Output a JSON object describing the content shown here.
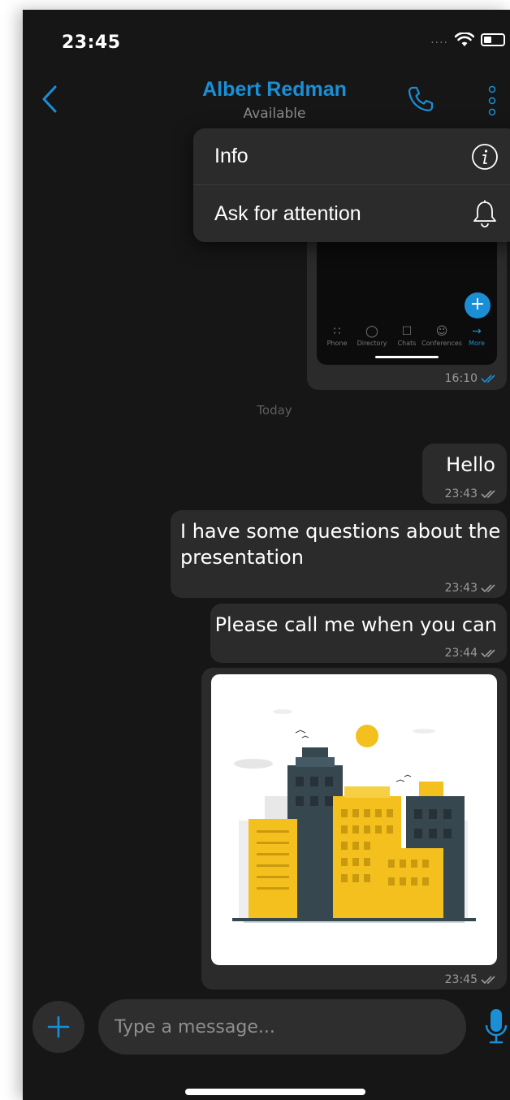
{
  "status_bar": {
    "time": "23:45",
    "signal": "....",
    "wifi_icon": "wifi-icon",
    "battery_icon": "battery-icon"
  },
  "header": {
    "back_icon": "chevron-left-icon",
    "contact_name": "Albert Redman",
    "contact_status": "Available",
    "call_icon": "phone-icon",
    "more_icon": "more-vertical-icon"
  },
  "menu": {
    "items": [
      {
        "label": "Info",
        "icon": "info-icon"
      },
      {
        "label": "Ask for attention",
        "icon": "bell-icon"
      }
    ]
  },
  "previous_message": {
    "nav_items": [
      "Phone",
      "Directory",
      "Chats",
      "Conferences",
      "More"
    ],
    "fab_label": "+",
    "time": "16:10"
  },
  "date_separator": "Today",
  "messages": [
    {
      "text": "Hello",
      "time": "23:43"
    },
    {
      "text": "I have some questions about the presentation",
      "time": "23:43"
    },
    {
      "text": "Please call me when you can",
      "time": "23:44"
    },
    {
      "image": "city-buildings-illustration",
      "time": "23:45"
    }
  ],
  "composer": {
    "placeholder": "Type a message...",
    "add_icon": "plus-icon",
    "mic_icon": "microphone-icon"
  },
  "colors": {
    "accent": "#1a8fd6",
    "background": "#161616",
    "bubble": "#2b2b2b",
    "illustration_yellow": "#f4c01e",
    "illustration_slate": "#37474f"
  }
}
